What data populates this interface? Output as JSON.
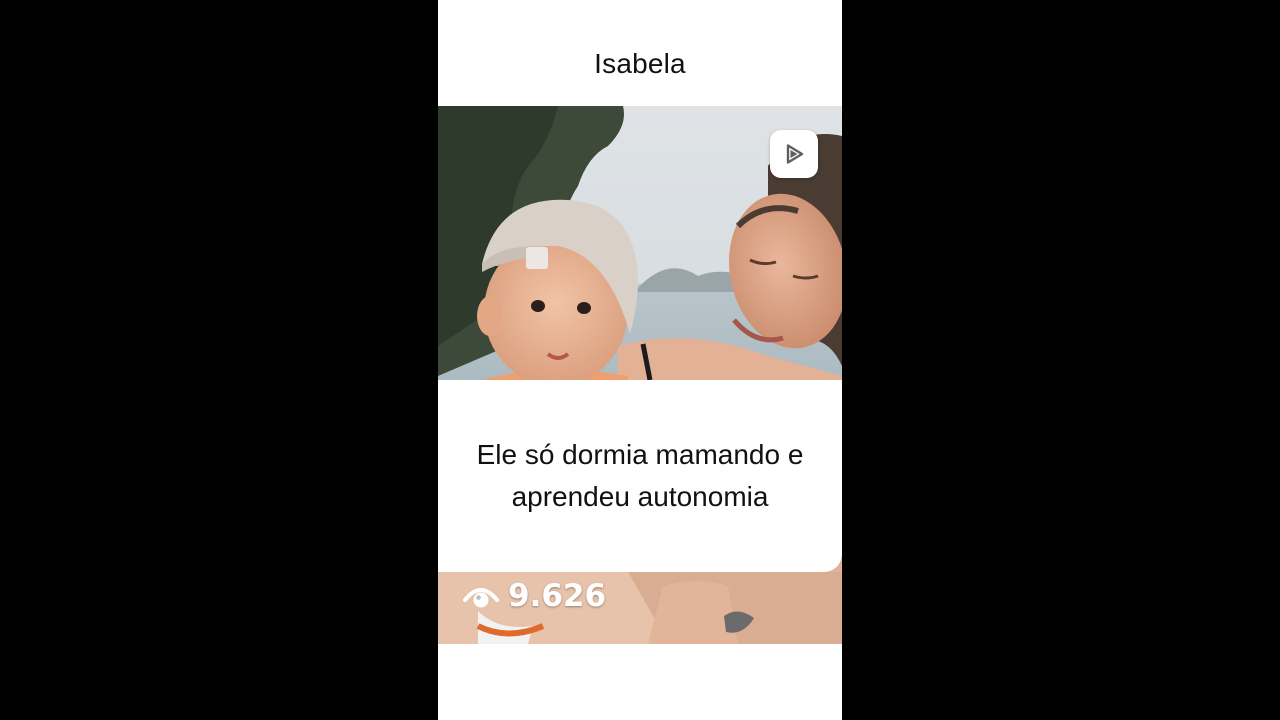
{
  "profile": {
    "name": "Isabela"
  },
  "post": {
    "caption": "Ele só dormia mamando e aprendeu autonomia",
    "views": "9.626",
    "play_icon": "play-icon",
    "views_icon": "eye-icon"
  },
  "colors": {
    "background": "#000000",
    "card": "#ffffff",
    "text": "#111111",
    "overlay_text": "#ffffff"
  }
}
